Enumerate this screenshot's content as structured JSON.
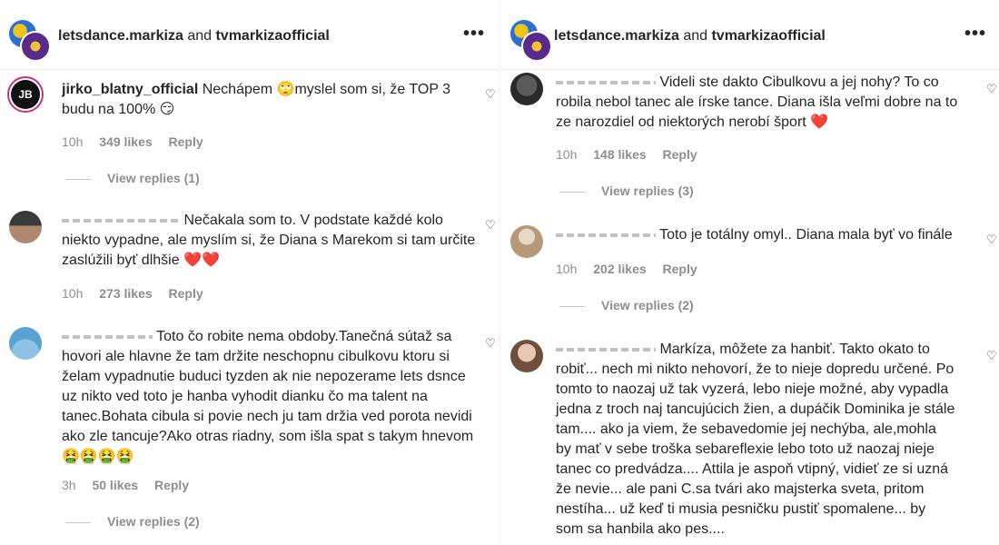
{
  "left": {
    "header": {
      "user1": "letsdance.markiza",
      "and": "and",
      "user2": "tvmarkizaofficial",
      "more": "•••"
    },
    "comments": [
      {
        "user": "jirko_blatny_official",
        "text": "Nechápem 🙄myslel som si, že TOP 3 budu na 100% 😏",
        "time": "10h",
        "likes": "349 likes",
        "reply": "Reply",
        "view_replies": "View replies (1)",
        "avatar": "JB"
      },
      {
        "user": "",
        "text": "Nečakala som to. V podstate každé kolo niekto vypadne, ale myslím si, že Diana s Marekom si tam určite zaslúžili byť dlhšie ❤️❤️",
        "time": "10h",
        "likes": "273 likes",
        "reply": "Reply"
      },
      {
        "user": "",
        "text": "Toto čo robite nema obdoby.Tanečná sútaž sa hovori ale hlavne že tam držite neschopnu cibulkovu ktoru si želam vypadnutie buduci tyzden ak nie nepozerame lets dsnce uz nikto ved toto je hanba vyhodit dianku čo ma talent na tanec.Bohata cibula si povie nech ju tam držia ved porota nevidi ako zle tancuje?Ako otras riadny, som išla spat s takym hnevom 🤮🤮🤮🤮",
        "time": "3h",
        "likes": "50 likes",
        "reply": "Reply",
        "view_replies": "View replies (2)"
      }
    ]
  },
  "right": {
    "header": {
      "user1": "letsdance.markiza",
      "and": "and",
      "user2": "tvmarkizaofficial",
      "more": "•••"
    },
    "comments": [
      {
        "user": "",
        "text": "Videli ste dakto Cibulkovu a jej nohy? To co robila nebol tanec ale írske tance. Diana išla veľmi dobre na to ze narozdiel od niektorých nerobí šport ❤️",
        "time": "10h",
        "likes": "148 likes",
        "reply": "Reply",
        "view_replies": "View replies (3)"
      },
      {
        "user": "",
        "text": "Toto je totálny omyl.. Diana mala byť vo finále",
        "time": "10h",
        "likes": "202 likes",
        "reply": "Reply",
        "view_replies": "View replies (2)"
      },
      {
        "user": "",
        "text": "Markíza, môžete za hanbiť. Takto okato to robiť... nech mi nikto nehovorí, že to nieje dopredu určené. Po tomto to naozaj už tak vyzerá, lebo nieje možné, aby vypadla jedna z troch naj tancujúcich žien, a dupáčik Dominika je stále tam.... ako ja viem, že sebavedomie jej nechýba, ale,mohla by mať v sebe troška sebareflexie lebo toto už naozaj nieje tanec co predvádza.... Attila je aspoň vtipný, vidieť ze si uzná že nevie... ale pani C.sa tvári ako majsterka sveta, pritom nestíha... už keď ti musia pesničku pustiť spomalene... by som sa hanbila ako pes...."
      }
    ]
  },
  "icons": {
    "heart": "heart-outline-icon",
    "more": "more-horizontal-icon"
  }
}
